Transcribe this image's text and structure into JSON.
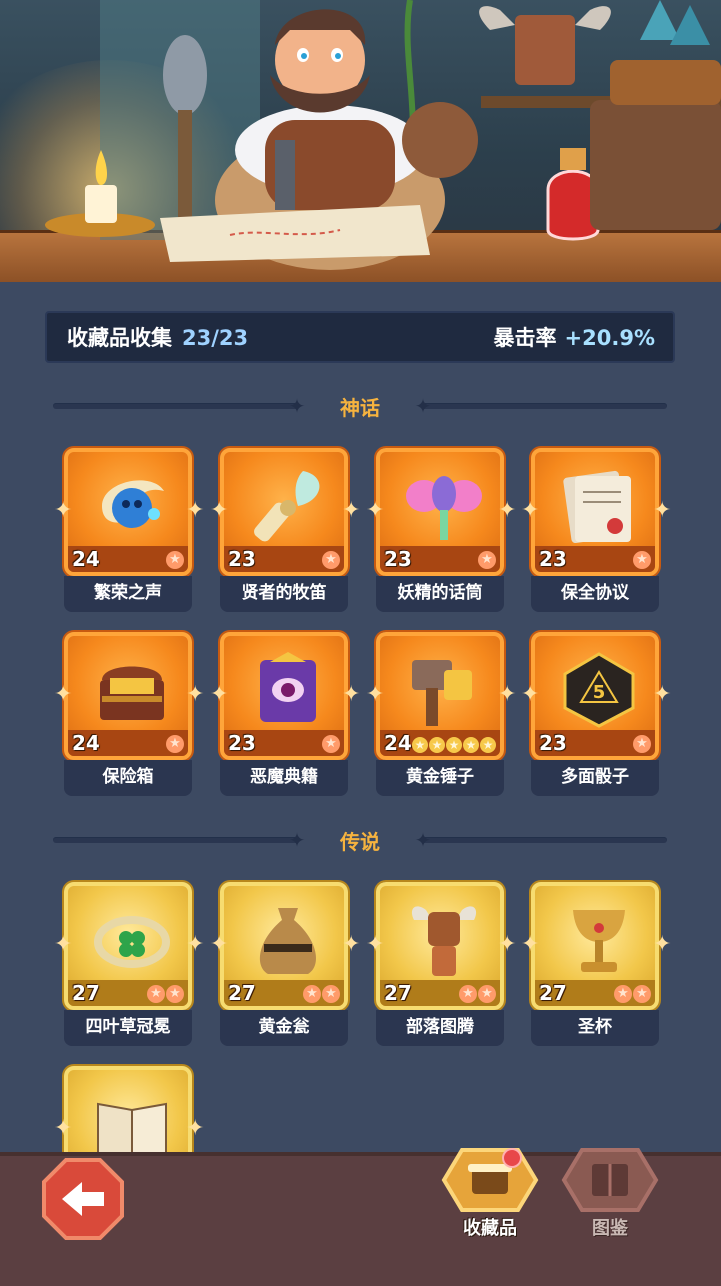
{
  "collection": {
    "label": "收藏品收集",
    "count": "23/23",
    "crit_label": "暴击率",
    "crit_value": "+20.9%"
  },
  "sections": {
    "mythic": {
      "title": "神话"
    },
    "legend": {
      "title": "传说"
    }
  },
  "mythic_items": [
    {
      "name": "繁荣之声",
      "level": "24",
      "stars": 1,
      "icon": "blue-spirit-orb-icon"
    },
    {
      "name": "贤者的牧笛",
      "level": "23",
      "stars": 1,
      "icon": "feather-flute-icon"
    },
    {
      "name": "妖精的话筒",
      "level": "23",
      "stars": 1,
      "icon": "fairy-microphone-icon"
    },
    {
      "name": "保全协议",
      "level": "23",
      "stars": 1,
      "icon": "sealed-contract-icon"
    },
    {
      "name": "保险箱",
      "level": "24",
      "stars": 1,
      "icon": "treasure-chest-icon"
    },
    {
      "name": "恶魔典籍",
      "level": "23",
      "stars": 1,
      "icon": "demon-tome-icon"
    },
    {
      "name": "黄金锤子",
      "level": "24",
      "stars": 5,
      "icon": "golden-hammer-icon"
    },
    {
      "name": "多面骰子",
      "level": "23",
      "stars": 1,
      "icon": "polyhedral-dice-icon"
    }
  ],
  "legend_items": [
    {
      "name": "四叶草冠冕",
      "level": "27",
      "stars": 2,
      "icon": "clover-crown-icon"
    },
    {
      "name": "黄金瓮",
      "level": "27",
      "stars": 2,
      "icon": "golden-urn-icon"
    },
    {
      "name": "部落图腾",
      "level": "27",
      "stars": 2,
      "icon": "tribal-totem-icon"
    },
    {
      "name": "圣杯",
      "level": "27",
      "stars": 2,
      "icon": "holy-grail-icon"
    }
  ],
  "partial_item": {
    "icon": "open-book-icon"
  },
  "nav": {
    "collection_label": "收藏品",
    "catalog_label": "图鉴"
  },
  "colors": {
    "mythic_frame": "#f6891d",
    "legend_frame": "#f2c74a",
    "section_title": "#f6b33f",
    "background": "#3d4a62"
  }
}
